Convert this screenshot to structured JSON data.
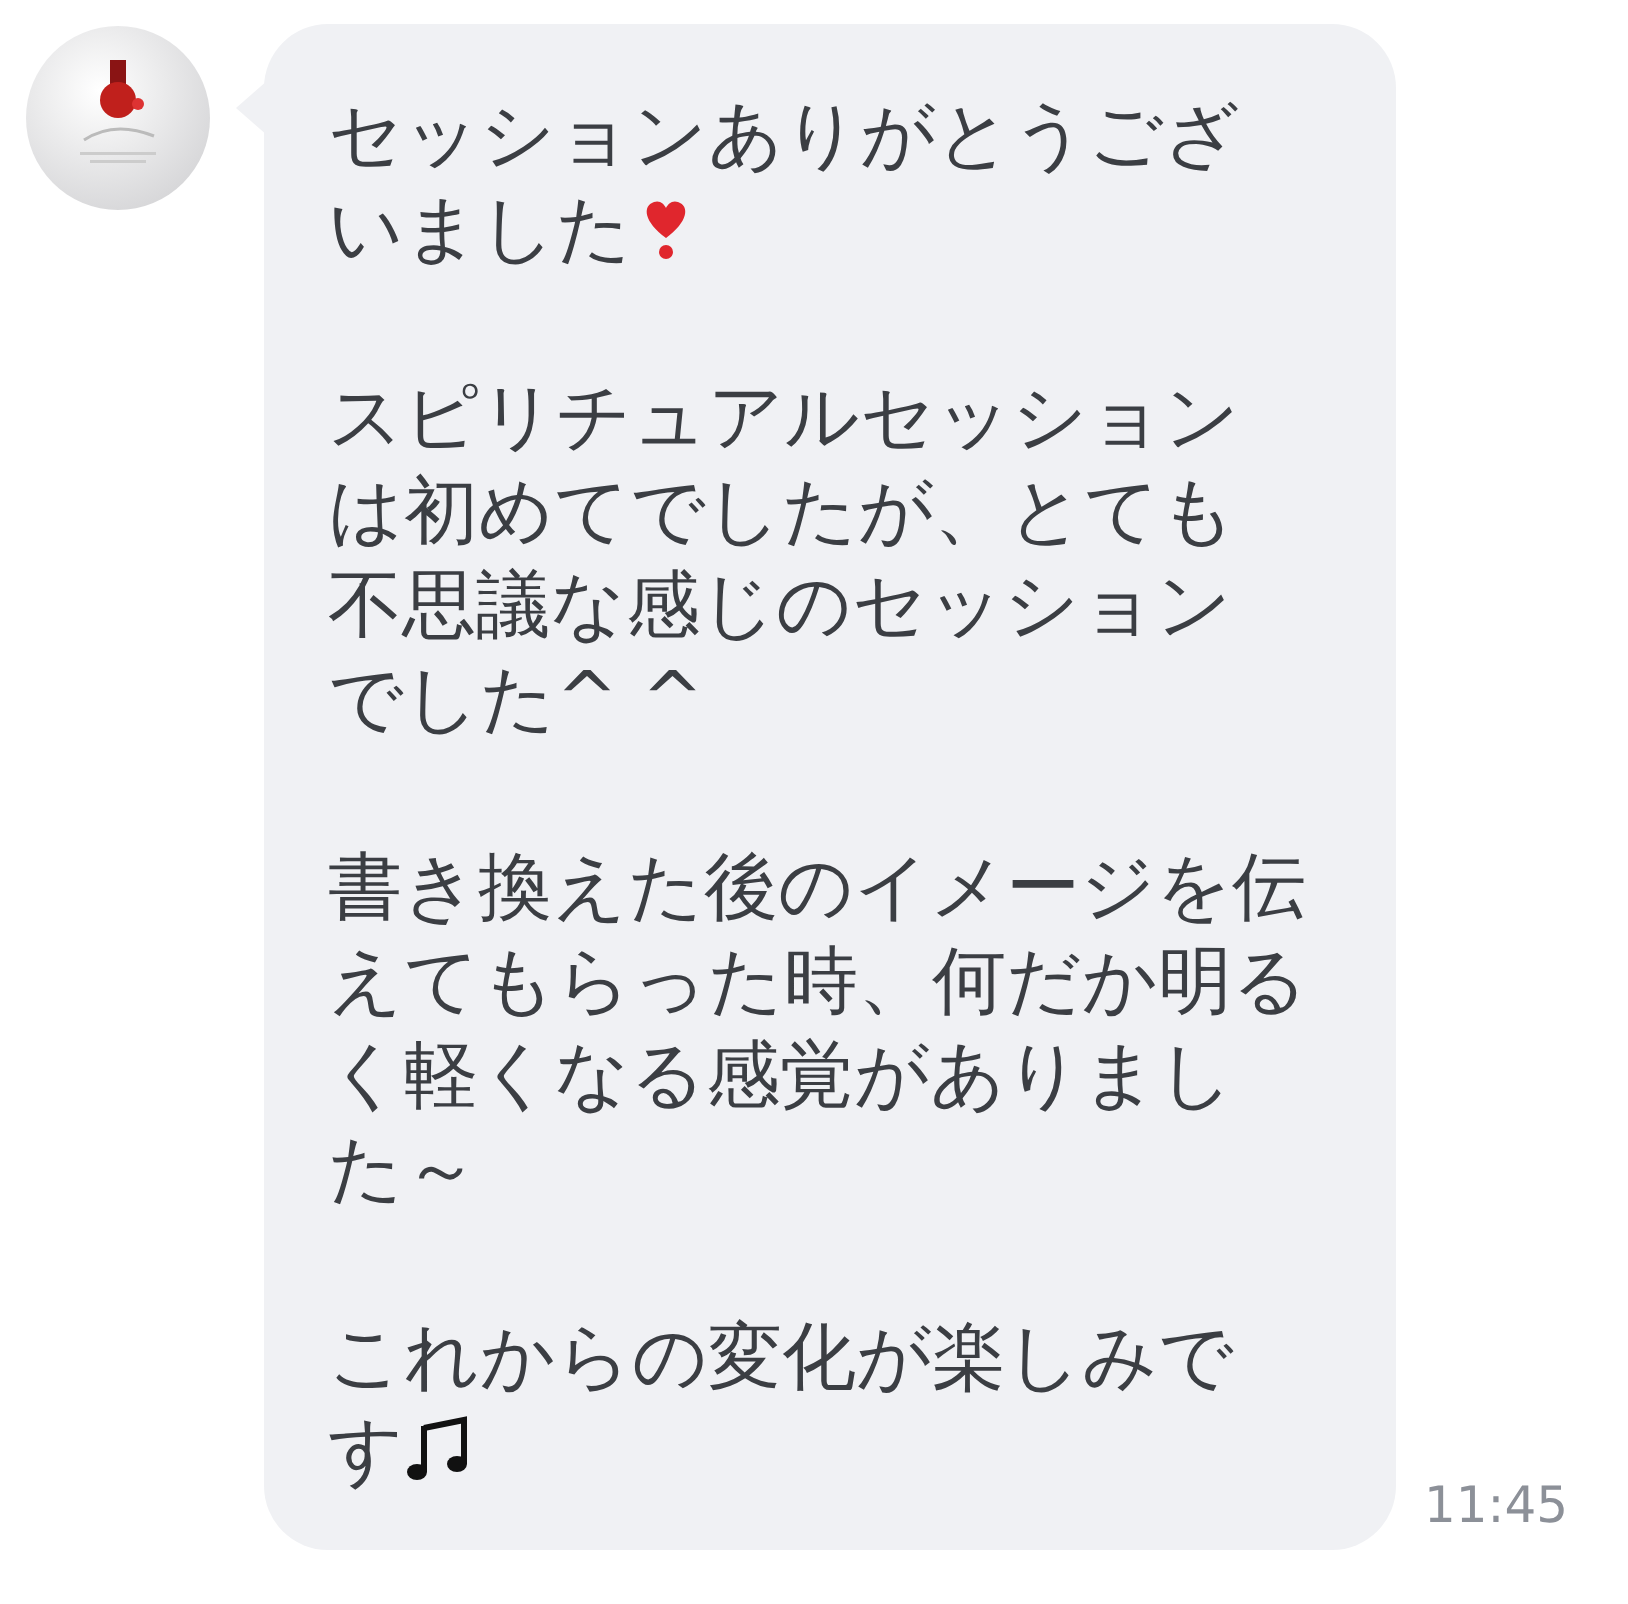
{
  "message": {
    "paragraphs": [
      {
        "lines": [
          "セッションありがとうござ",
          "いました"
        ],
        "kind": "heart-exclamation"
      },
      {
        "lines": [
          "スピリチュアルセッション",
          "は初めてでしたが、とても",
          "不思議な感じのセッション",
          "でした^ ^"
        ]
      },
      {
        "lines": [
          "書き換えた後のイメージを伝",
          "えてもらった時、何だか明る",
          "く軽くなる感覚がありまし",
          "た～"
        ]
      },
      {
        "lines": [
          "これからの変化が楽しみで",
          "す"
        ],
        "kind": "music-notes"
      }
    ],
    "time": "11:45"
  }
}
